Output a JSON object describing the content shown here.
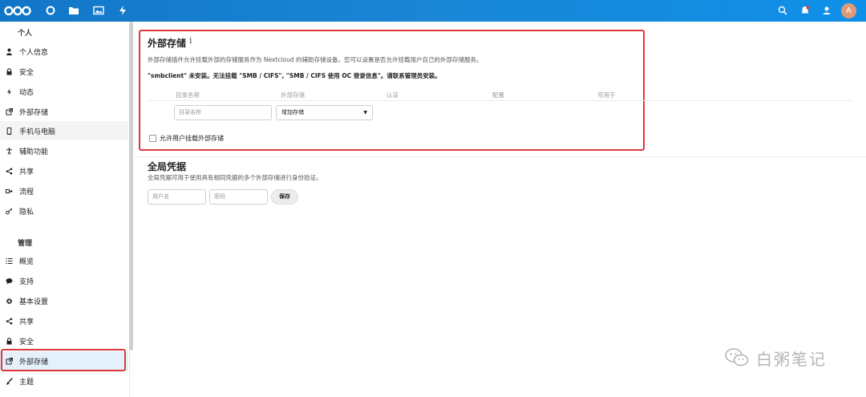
{
  "header": {
    "avatar_letter": "A",
    "icons": [
      "nextcloud-logo",
      "dashboard-icon",
      "files-icon",
      "photos-icon",
      "activity-icon",
      "search-icon",
      "notifications-icon",
      "contacts-icon"
    ]
  },
  "sidebar": {
    "personal_caption": "个人",
    "personal_items": [
      {
        "label": "个人信息",
        "icon": "user-icon"
      },
      {
        "label": "安全",
        "icon": "lock-icon"
      },
      {
        "label": "动态",
        "icon": "activity-icon"
      },
      {
        "label": "外部存储",
        "icon": "external-link-icon"
      },
      {
        "label": "手机与电脑",
        "icon": "phone-icon"
      },
      {
        "label": "辅助功能",
        "icon": "accessibility-icon"
      },
      {
        "label": "共享",
        "icon": "share-icon"
      },
      {
        "label": "流程",
        "icon": "flow-icon"
      },
      {
        "label": "隐私",
        "icon": "key-icon"
      }
    ],
    "admin_caption": "管理",
    "admin_items": [
      {
        "label": "概览",
        "icon": "list-icon"
      },
      {
        "label": "支持",
        "icon": "comment-icon"
      },
      {
        "label": "基本设置",
        "icon": "gear-icon"
      },
      {
        "label": "共享",
        "icon": "share-icon"
      },
      {
        "label": "安全",
        "icon": "lock-icon"
      },
      {
        "label": "外部存储",
        "icon": "external-link-icon"
      },
      {
        "label": "主题",
        "icon": "brush-icon"
      }
    ]
  },
  "external_storage": {
    "title": "外部存储",
    "info_glyph": "i",
    "description": "外部存储插件允许挂载外部的存储服务作为 Nextcloud 的辅助存储设备。您可以设置是否允许挂载用户自己的外部存储服务。",
    "warning": "\"smbclient\" 未安装。无法挂载 \"SMB / CIFS\", \"SMB / CIFS 使用 OC 登录信息\"。请联系管理员安装。",
    "columns": [
      "目录名称",
      "外部存储",
      "认证",
      "配置",
      "可用于"
    ],
    "folder_placeholder": "目录名称",
    "add_storage": "增加存储",
    "allow_user_mount": "允许用户挂载外部存储"
  },
  "global_credentials": {
    "title": "全局凭据",
    "description": "全局凭据可用于使用具有相同凭据的多个外部存储进行身份验证。",
    "username_placeholder": "用户名",
    "password_placeholder": "密码",
    "save_label": "保存"
  },
  "watermark": {
    "text": "白粥笔记"
  },
  "colors": {
    "header": "#1a86d6",
    "highlight": "#e0393b",
    "active_bg": "#e4f1fb"
  }
}
